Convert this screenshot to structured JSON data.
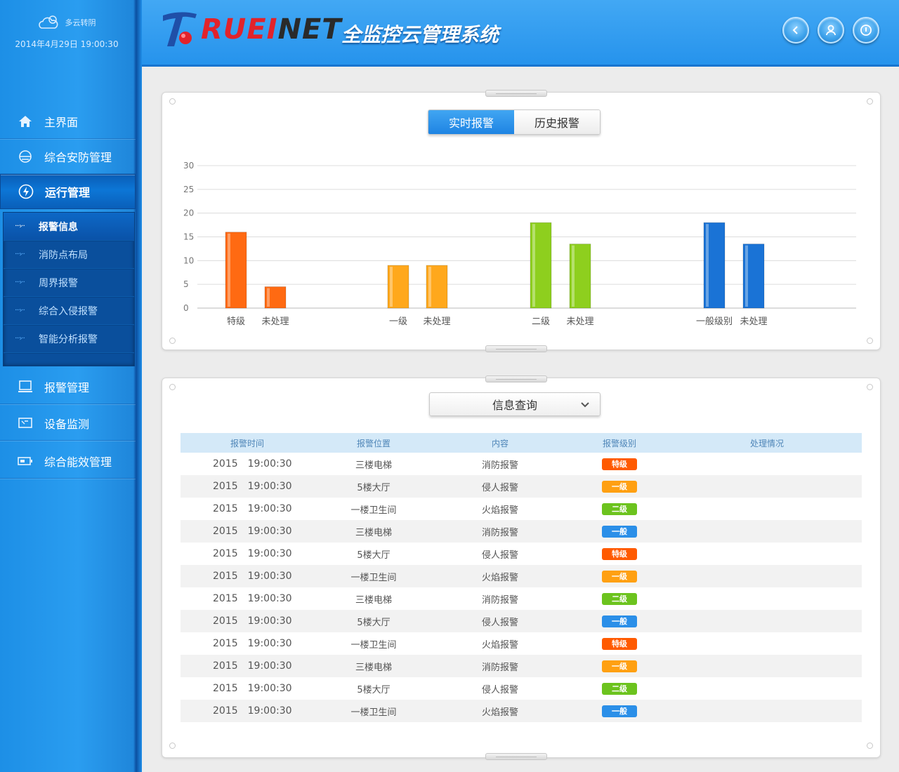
{
  "sidebar": {
    "weather": {
      "text": "多云转阴",
      "datetime": "2014年4月29日 19:00:30"
    },
    "nav": [
      {
        "label": "主界面"
      },
      {
        "label": "综合安防管理"
      },
      {
        "label": "运行管理"
      },
      {
        "label": "报警管理"
      },
      {
        "label": "设备监测"
      },
      {
        "label": "综合能效管理"
      }
    ],
    "subnav": [
      {
        "label": "报警信息"
      },
      {
        "label": "消防点布局"
      },
      {
        "label": "周界报警"
      },
      {
        "label": "综合入侵报警"
      },
      {
        "label": "智能分析报警"
      }
    ]
  },
  "header": {
    "logo_red": "RUEI",
    "logo_dark": "NET",
    "title": "全监控云管理系统"
  },
  "alarm_tabs": {
    "realtime": "实时报警",
    "history": "历史报警"
  },
  "chart_data": {
    "type": "bar",
    "ylim": [
      0,
      30
    ],
    "yticks": [
      0,
      5,
      10,
      15,
      20,
      25,
      30
    ],
    "grid": true,
    "categories": [
      "特级",
      "未处理",
      "一级",
      "未处理",
      "二级",
      "未处理",
      "一般级别",
      "未处理"
    ],
    "values": [
      16,
      4.5,
      9,
      9,
      18,
      13.5,
      18,
      13.5
    ],
    "colors": [
      "#ff6a12",
      "#ff6a12",
      "#ffa81c",
      "#ffa81c",
      "#8ecf1e",
      "#8ecf1e",
      "#1a73d6",
      "#1a73d6"
    ]
  },
  "query": {
    "label": "信息查询"
  },
  "table": {
    "headers": [
      "报警时间",
      "报警位置",
      "内容",
      "报警级别",
      "处理情况"
    ],
    "rows": [
      {
        "date": "2015",
        "time": "19:00:30",
        "location": "三楼电梯",
        "content": "消防报警",
        "level": "特级",
        "color": "#ff5a00"
      },
      {
        "date": "2015",
        "time": "19:00:30",
        "location": "5楼大厅",
        "content": "侵人报警",
        "level": "一级",
        "color": "#ffa012"
      },
      {
        "date": "2015",
        "time": "19:00:30",
        "location": "一楼卫生间",
        "content": "火焰报警",
        "level": "二级",
        "color": "#6cc31e"
      },
      {
        "date": "2015",
        "time": "19:00:30",
        "location": "三楼电梯",
        "content": "消防报警",
        "level": "一般",
        "color": "#2b8fe8"
      },
      {
        "date": "2015",
        "time": "19:00:30",
        "location": "5楼大厅",
        "content": "侵人报警",
        "level": "特级",
        "color": "#ff5a00"
      },
      {
        "date": "2015",
        "time": "19:00:30",
        "location": "一楼卫生间",
        "content": "火焰报警",
        "level": "一级",
        "color": "#ffa012"
      },
      {
        "date": "2015",
        "time": "19:00:30",
        "location": "三楼电梯",
        "content": "消防报警",
        "level": "二级",
        "color": "#6cc31e"
      },
      {
        "date": "2015",
        "time": "19:00:30",
        "location": "5楼大厅",
        "content": "侵人报警",
        "level": "一般",
        "color": "#2b8fe8"
      },
      {
        "date": "2015",
        "time": "19:00:30",
        "location": "一楼卫生间",
        "content": "火焰报警",
        "level": "特级",
        "color": "#ff5a00"
      },
      {
        "date": "2015",
        "time": "19:00:30",
        "location": "三楼电梯",
        "content": "消防报警",
        "level": "一级",
        "color": "#ffa012"
      },
      {
        "date": "2015",
        "time": "19:00:30",
        "location": "5楼大厅",
        "content": "侵人报警",
        "level": "二级",
        "color": "#6cc31e"
      },
      {
        "date": "2015",
        "time": "19:00:30",
        "location": "一楼卫生间",
        "content": "火焰报警",
        "level": "一般",
        "color": "#2b8fe8"
      }
    ]
  }
}
